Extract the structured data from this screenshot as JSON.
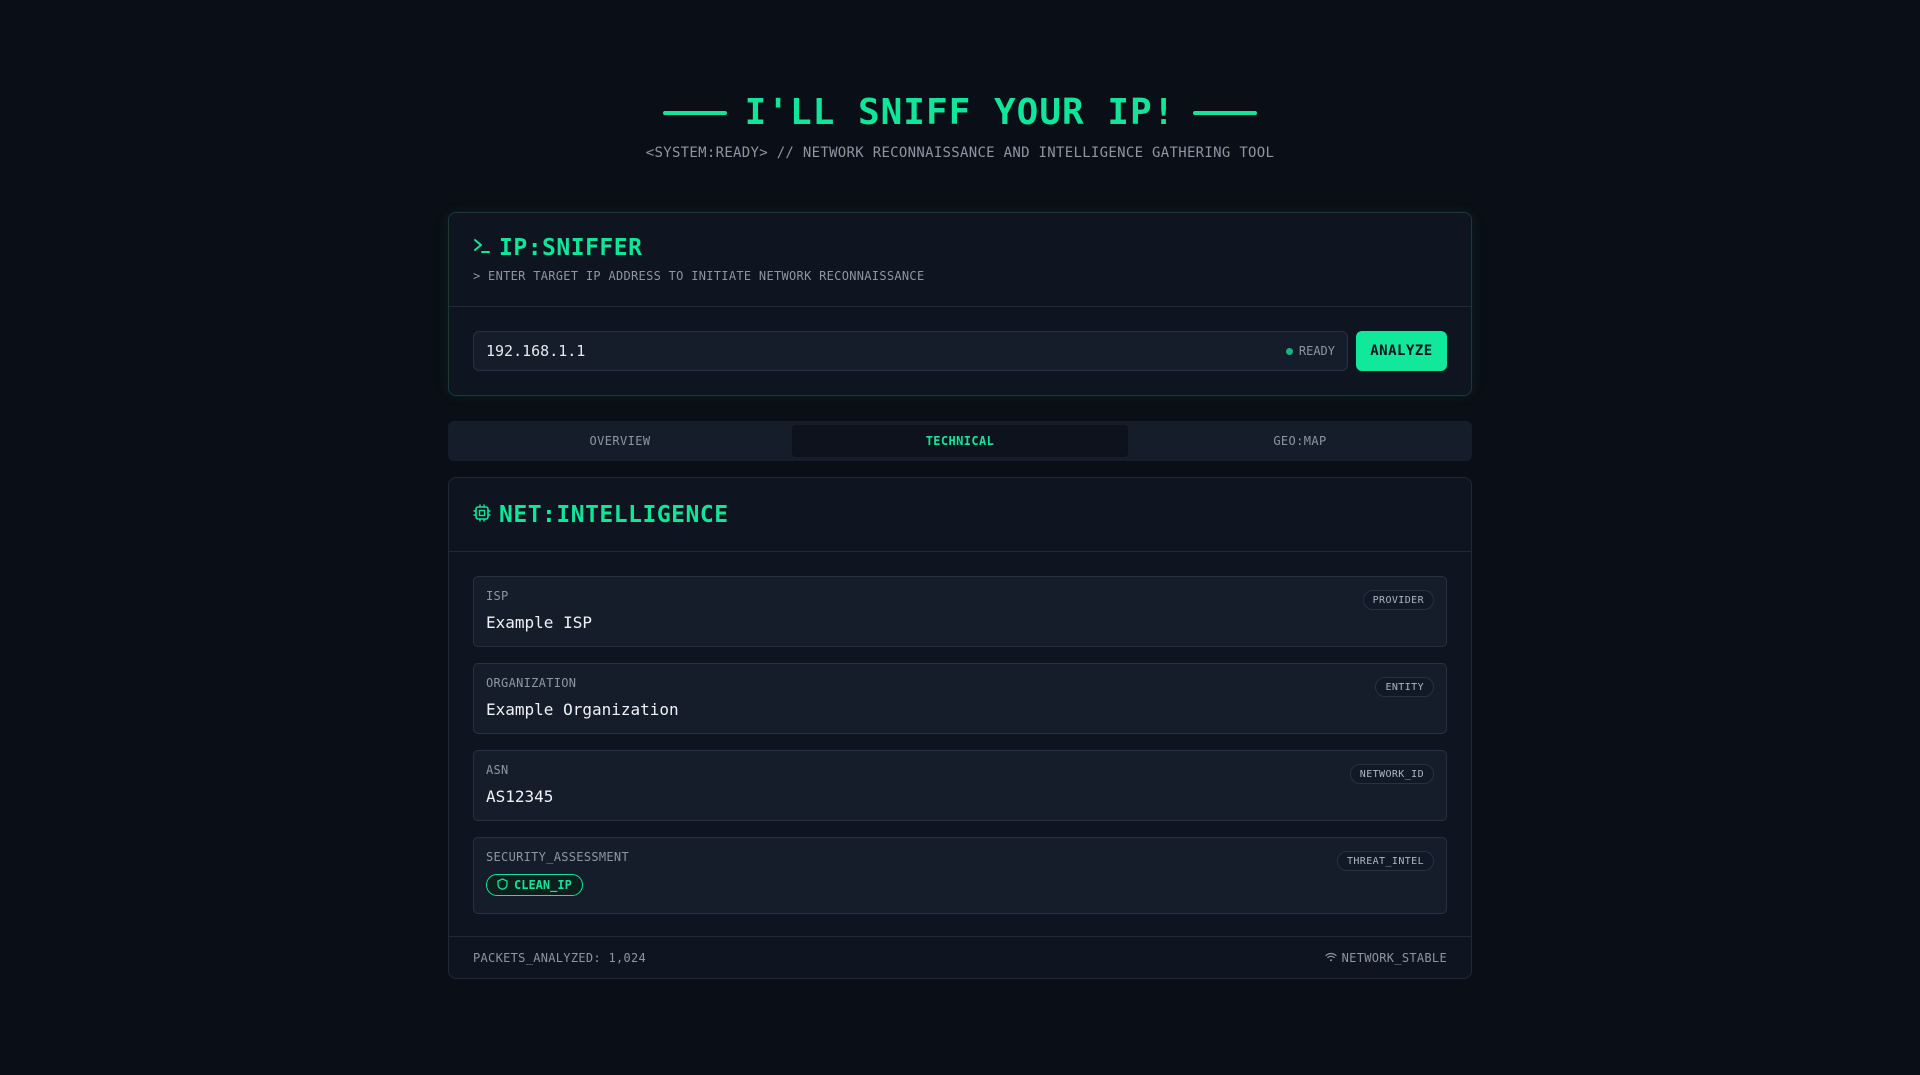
{
  "header": {
    "title": "I'LL SNIFF YOUR IP!",
    "subtitle": "<SYSTEM:READY> // NETWORK RECONNAISSANCE AND INTELLIGENCE GATHERING TOOL"
  },
  "sniffer": {
    "icon": "terminal-icon",
    "title": "IP:SNIFFER",
    "subtitle": "> ENTER TARGET IP ADDRESS TO INITIATE NETWORK RECONNAISSANCE",
    "input_value": "192.168.1.1",
    "status": "READY",
    "analyze_label": "ANALYZE"
  },
  "tabs": [
    {
      "label": "OVERVIEW",
      "active": false
    },
    {
      "label": "TECHNICAL",
      "active": true
    },
    {
      "label": "GEO:MAP",
      "active": false
    }
  ],
  "intel": {
    "icon": "cpu-icon",
    "title": "NET:INTELLIGENCE",
    "rows": [
      {
        "label": "ISP",
        "value": "Example ISP",
        "badge": "PROVIDER"
      },
      {
        "label": "ORGANIZATION",
        "value": "Example Organization",
        "badge": "ENTITY"
      },
      {
        "label": "ASN",
        "value": "AS12345",
        "badge": "NETWORK_ID"
      },
      {
        "label": "SECURITY_ASSESSMENT",
        "value": "CLEAN_IP",
        "badge": "THREAT_INTEL"
      }
    ],
    "footer_left": "PACKETS_ANALYZED: 1,024",
    "footer_right": "NETWORK_STABLE"
  },
  "colors": {
    "accent": "#10e59a",
    "background": "#0a0e16",
    "card": "#0e1420"
  }
}
